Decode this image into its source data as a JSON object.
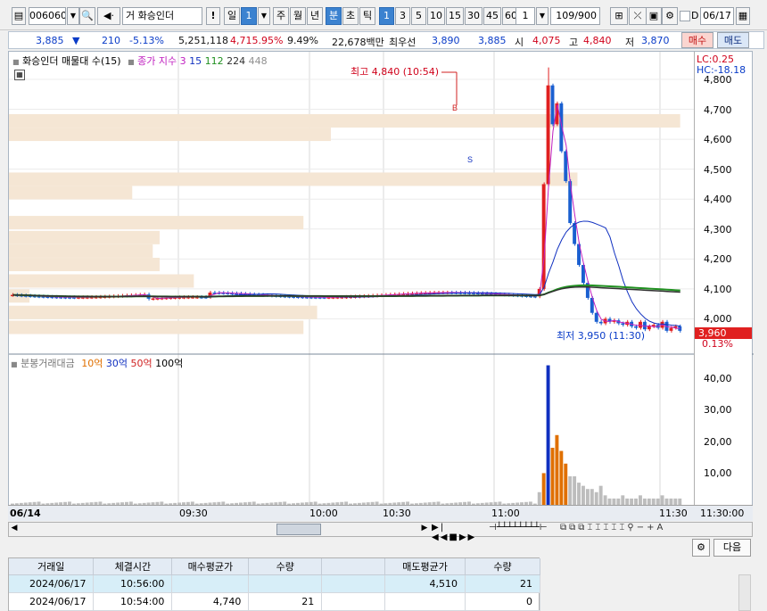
{
  "toolbar": {
    "code": "006060",
    "market_prefix": "거",
    "name": "화승인더",
    "periods": [
      "일",
      "1",
      "주",
      "월",
      "년",
      "분",
      "초",
      "틱"
    ],
    "intervals": [
      "1",
      "3",
      "5",
      "10",
      "15",
      "30",
      "45",
      "60"
    ],
    "unit": "1",
    "count": "109/900",
    "checkbox_label": "D",
    "date": "06/17"
  },
  "quote": {
    "price": "3,885",
    "arrow": "▼",
    "change": "210",
    "change_pct": "-5.13%",
    "volume": "5,251,118",
    "vol_pct": "4,715.95%",
    "turnover_pct": "9.49%",
    "amount": "22,678백만",
    "best_label": "최우선",
    "bid_best": "3,890",
    "ask_best": "3,885",
    "open_label": "시",
    "open": "4,075",
    "high_label": "고",
    "high": "4,840",
    "low_label": "저",
    "low": "3,870",
    "buy_label": "매수",
    "sell_label": "매도"
  },
  "chart_data": [
    {
      "type": "candlestick",
      "title": "화승인더 매물대 수(15)",
      "legend": [
        "종가 지수 3",
        "15",
        "112",
        "224",
        "448"
      ],
      "ylim": [
        3900,
        4800
      ],
      "y_ticks": [
        "4,800",
        "4,700",
        "4,600",
        "4,500",
        "4,400",
        "4,300",
        "4,200",
        "4,100",
        "4,000"
      ],
      "annotations": {
        "high": "최고 4,840 (10:54)",
        "low": "최저 3,950 (11:30)",
        "lc": "LC:0.25",
        "hc": "HC:-18.18",
        "last_price": "3,960",
        "last_pct": "0.13%"
      },
      "colors": {
        "up": "#e02020",
        "down": "#1a5fd0",
        "ma3": "#c020c0",
        "ma15": "#1030c0",
        "ma112": "#209020",
        "ma224": "#303030",
        "profile": "#f5e6d4"
      },
      "volume_profile": [
        {
          "price": 4660,
          "width": 0.98
        },
        {
          "price": 4615,
          "width": 0.47
        },
        {
          "price": 4465,
          "width": 0.83
        },
        {
          "price": 4420,
          "width": 0.18
        },
        {
          "price": 4320,
          "width": 0.43
        },
        {
          "price": 4270,
          "width": 0.22
        },
        {
          "price": 4225,
          "width": 0.21
        },
        {
          "price": 4180,
          "width": 0.22
        },
        {
          "price": 4125,
          "width": 0.27
        },
        {
          "price": 4075,
          "width": 0.03
        },
        {
          "price": 4020,
          "width": 0.45
        },
        {
          "price": 3970,
          "width": 0.43
        }
      ]
    },
    {
      "type": "bar",
      "title": "분봉거래대금",
      "legend": [
        "10억",
        "30억",
        "50억",
        "100억"
      ],
      "legend_colors": [
        "#e07000",
        "#1030c0",
        "#d02020",
        "#000000"
      ],
      "ylim": [
        0,
        45
      ],
      "y_ticks": [
        "40,00",
        "30,00",
        "20,00",
        "10,00"
      ]
    }
  ],
  "time_axis": [
    "06/14",
    "09:30",
    "10:00",
    "10:30",
    "11:00",
    "11:30",
    "11:30:00"
  ],
  "grid": {
    "headers": [
      "거래일",
      "체결시간",
      "매수평균가",
      "수량",
      "",
      "매도평균가",
      "수량"
    ],
    "rows": [
      [
        "2024/06/17",
        "10:56:00",
        "",
        "",
        "",
        "4,510",
        "21"
      ],
      [
        "2024/06/17",
        "10:54:00",
        "4,740",
        "21",
        "",
        "",
        "0"
      ]
    ]
  },
  "next_label": "다음"
}
